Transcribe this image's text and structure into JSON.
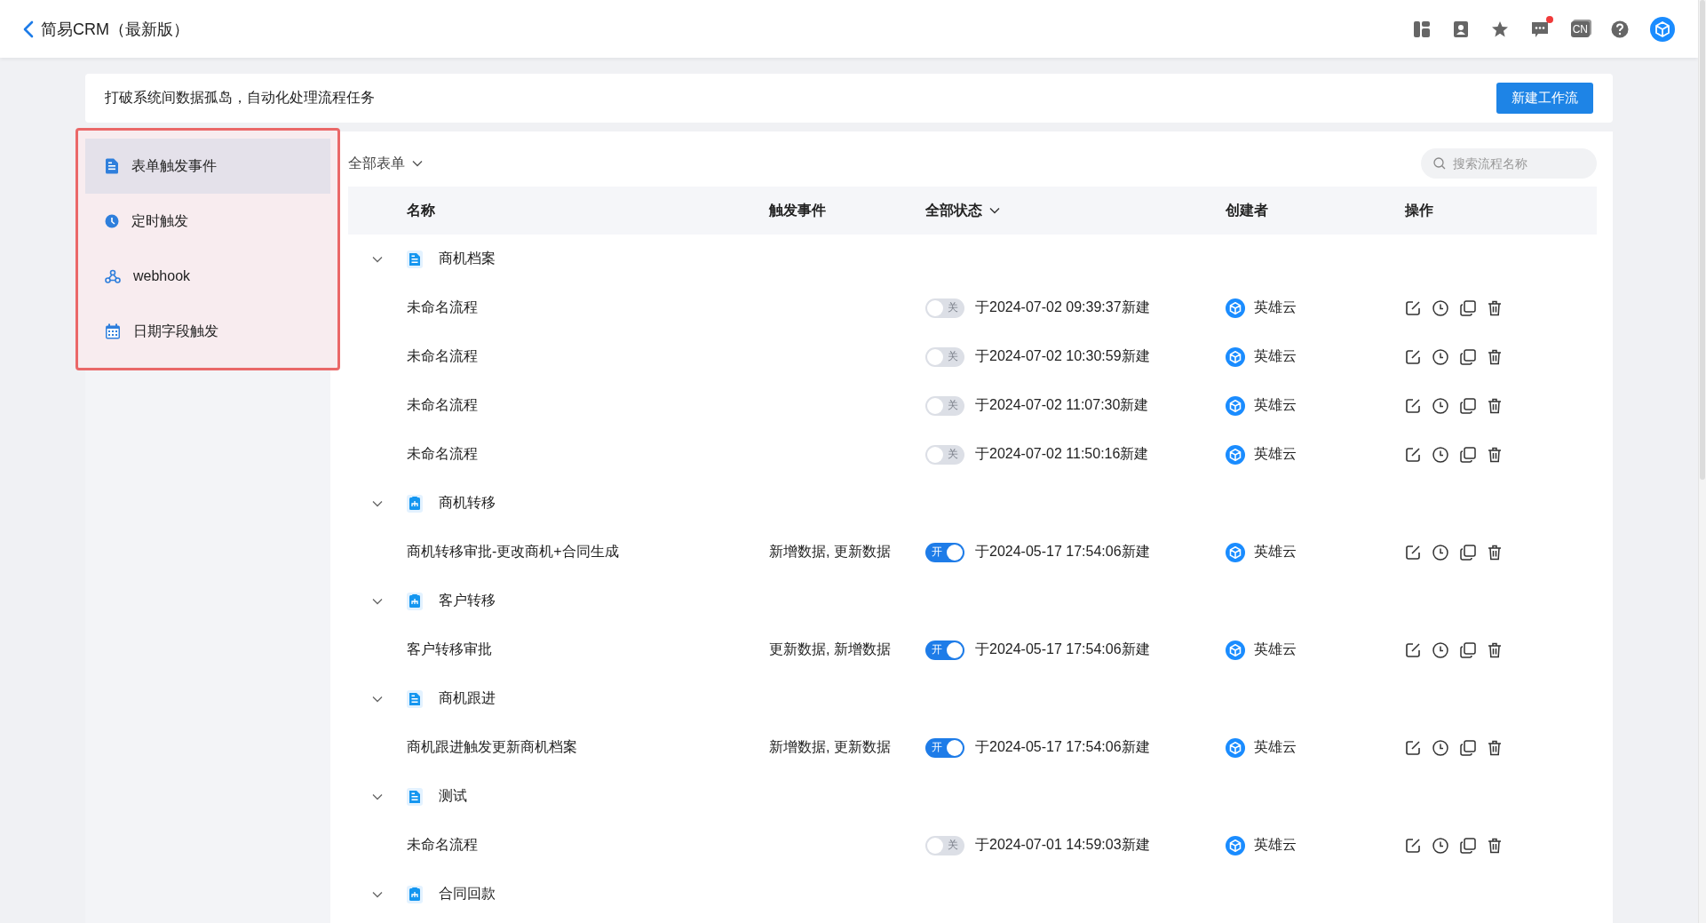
{
  "app_bar": {
    "title": "简易CRM（最新版）",
    "language_badge": "CN",
    "has_unread_messages": true
  },
  "banner": {
    "text": "打破系统间数据孤岛，自动化处理流程任务",
    "button": "新建工作流"
  },
  "sidebar": {
    "items": [
      {
        "label": "表单触发事件",
        "kind": "form",
        "selected": true
      },
      {
        "label": "定时触发",
        "kind": "timer",
        "selected": false
      },
      {
        "label": "webhook",
        "kind": "webhook",
        "selected": false
      },
      {
        "label": "日期字段触发",
        "kind": "date",
        "selected": false
      }
    ]
  },
  "filter": {
    "label": "全部表单"
  },
  "search": {
    "placeholder": "搜索流程名称"
  },
  "table": {
    "columns": [
      {
        "label": "名称",
        "dropdown": false
      },
      {
        "label": "触发事件",
        "dropdown": false
      },
      {
        "label": "全部状态",
        "dropdown": true
      },
      {
        "label": "创建者",
        "dropdown": false
      },
      {
        "label": "操作",
        "dropdown": false
      }
    ],
    "groups": [
      {
        "title": "商机档案",
        "kind": "form",
        "expanded": true,
        "rows": [
          {
            "name": "未命名流程",
            "on": false,
            "toggle_label": "关",
            "created": "于2024-07-02 09:39:37新建",
            "creator": "英雄云"
          },
          {
            "name": "未命名流程",
            "on": false,
            "toggle_label": "关",
            "created": "于2024-07-02 10:30:59新建",
            "creator": "英雄云"
          },
          {
            "name": "未命名流程",
            "on": false,
            "toggle_label": "关",
            "created": "于2024-07-02 11:07:30新建",
            "creator": "英雄云"
          },
          {
            "name": "未命名流程",
            "on": false,
            "toggle_label": "关",
            "created": "于2024-07-02 11:50:16新建",
            "creator": "英雄云"
          }
        ]
      },
      {
        "title": "商机转移",
        "kind": "process",
        "expanded": true,
        "rows": [
          {
            "name": "商机转移审批-更改商机+合同生成",
            "triggers": "新增数据, 更新数据",
            "on": true,
            "toggle_label": "开",
            "created": "于2024-05-17 17:54:06新建",
            "creator": "英雄云"
          }
        ]
      },
      {
        "title": "客户转移",
        "kind": "process",
        "expanded": true,
        "rows": [
          {
            "name": "客户转移审批",
            "triggers": "更新数据, 新增数据",
            "on": true,
            "toggle_label": "开",
            "created": "于2024-05-17 17:54:06新建",
            "creator": "英雄云"
          }
        ]
      },
      {
        "title": "商机跟进",
        "kind": "form",
        "expanded": true,
        "rows": [
          {
            "name": "商机跟进触发更新商机档案",
            "triggers": "新增数据, 更新数据",
            "on": true,
            "toggle_label": "开",
            "created": "于2024-05-17 17:54:06新建",
            "creator": "英雄云"
          }
        ]
      },
      {
        "title": "测试",
        "kind": "form",
        "expanded": true,
        "rows": [
          {
            "name": "未命名流程",
            "on": false,
            "toggle_label": "关",
            "created": "于2024-07-01 14:59:03新建",
            "creator": "英雄云"
          }
        ]
      },
      {
        "title": "合同回款",
        "kind": "process",
        "expanded": true
      }
    ]
  }
}
